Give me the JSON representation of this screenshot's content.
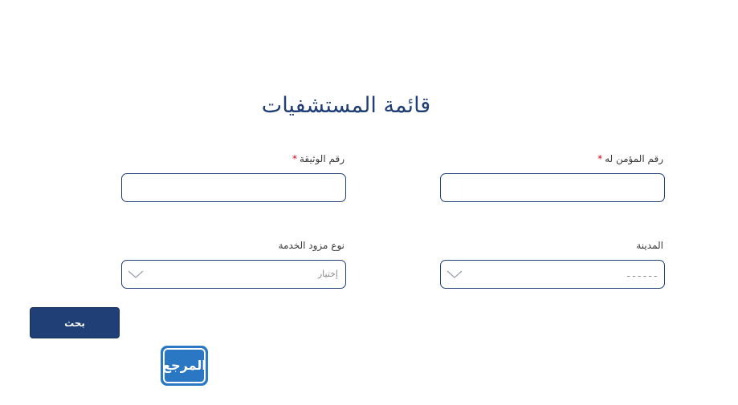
{
  "page_title": "قائمة المستشفيات",
  "form": {
    "insured_number": {
      "label": "رقم المؤمن له",
      "required_mark": "*",
      "value": ""
    },
    "document_number": {
      "label": "رقم الوثيقة",
      "required_mark": "*",
      "value": ""
    },
    "city": {
      "label": "المدينة",
      "selected": "ـ ـ ـ ـ ـ ـ",
      "icon": "chevron-down-icon"
    },
    "provider_type": {
      "label": "نوع مزود الخدمة",
      "selected": "إختيار",
      "icon": "chevron-down-icon"
    }
  },
  "search_button": {
    "label": "بحث",
    "color": "#1f3f76"
  },
  "logo": {
    "text": "المرجع",
    "color": "#2a77c4"
  },
  "colors": {
    "accent": "#1f3f76",
    "required": "#d0021b"
  }
}
